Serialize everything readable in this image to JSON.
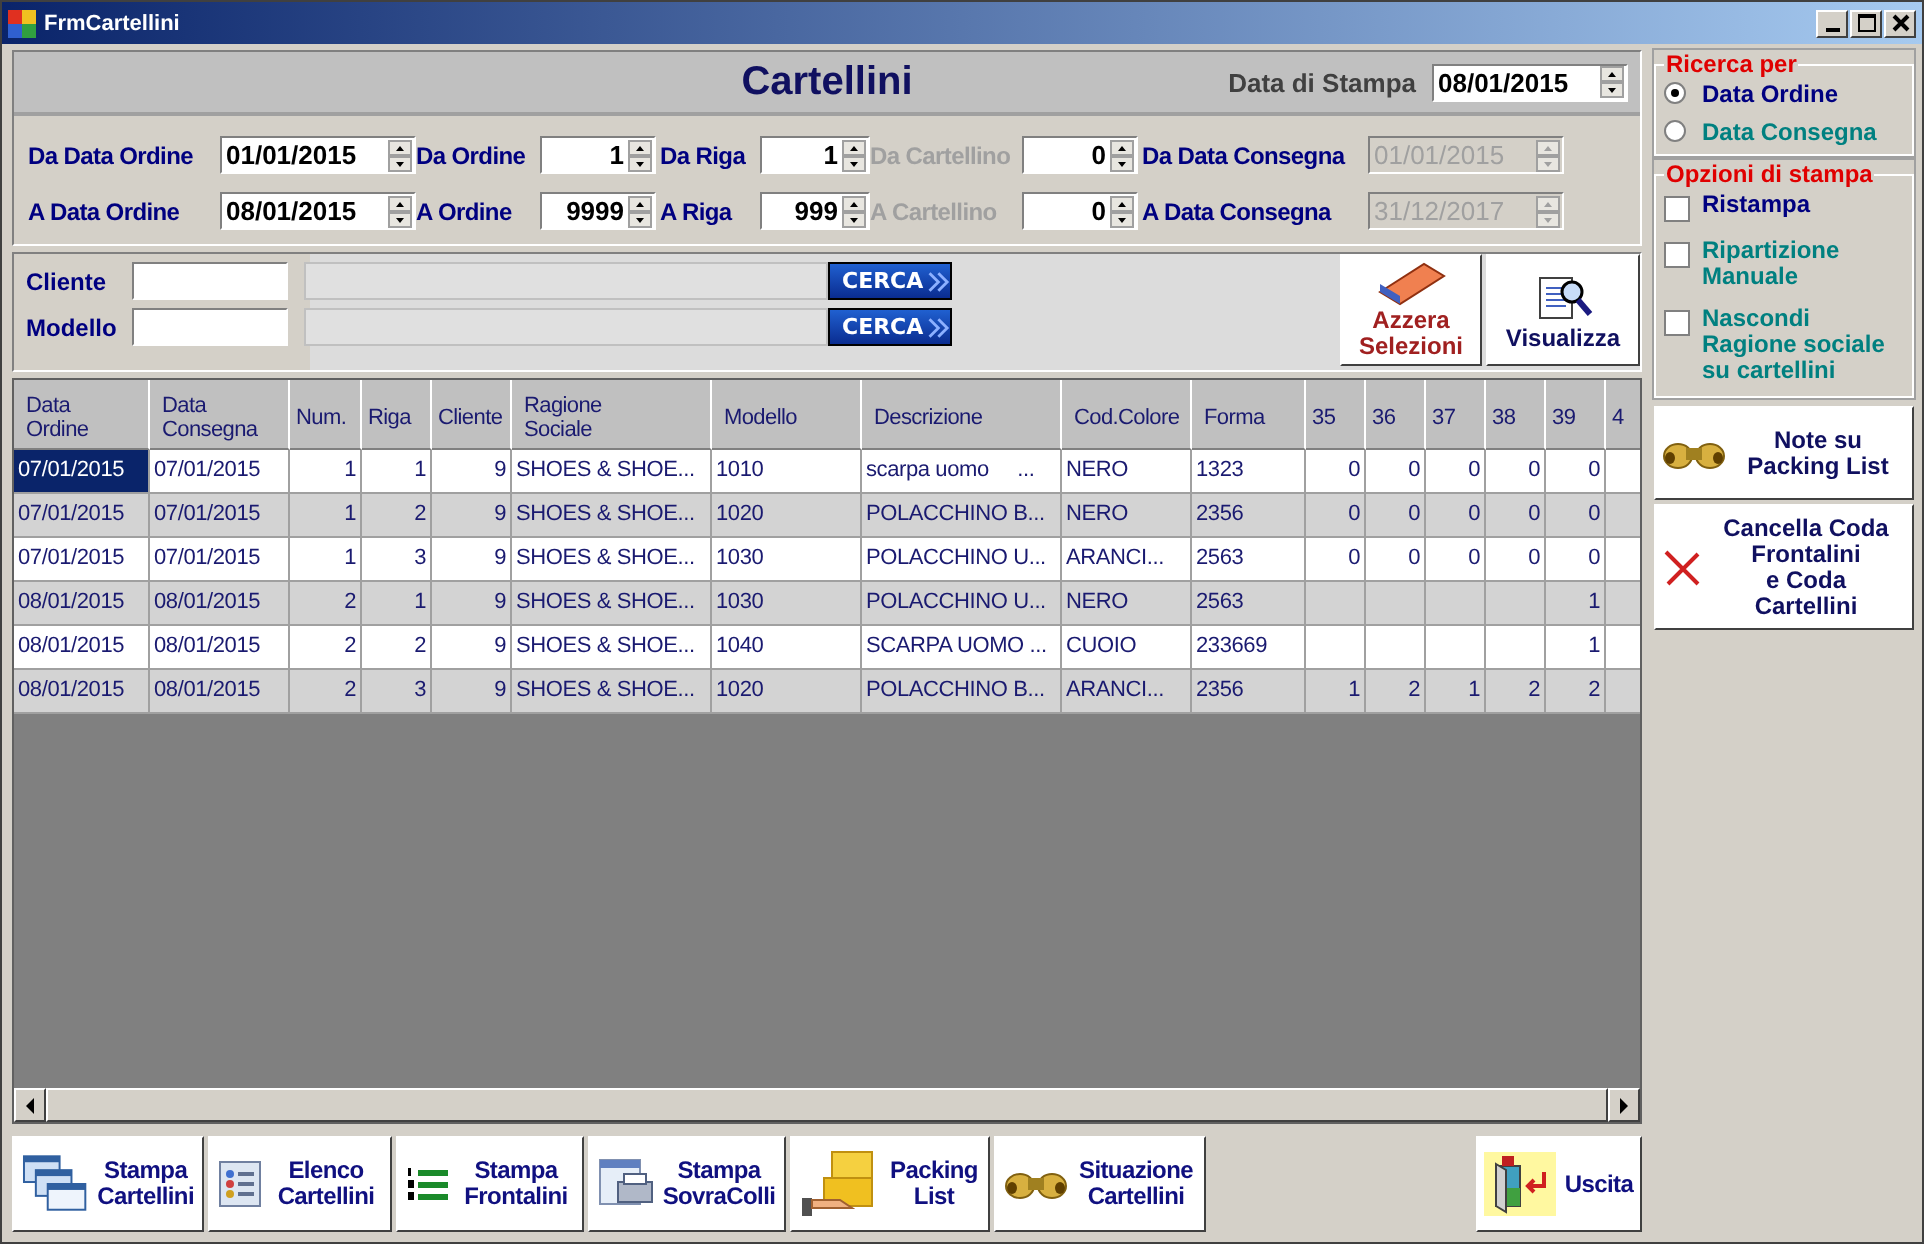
{
  "window": {
    "title": "FrmCartellini"
  },
  "header": {
    "title": "Cartellini",
    "print_date_label": "Data di Stampa",
    "print_date": "08/01/2015"
  },
  "filters": [
    [
      {
        "label": "Da Data Ordine",
        "value": "01/01/2015",
        "kind": "date",
        "label_disabled": false,
        "disabled": false
      },
      {
        "label": "Da Ordine",
        "value": "1",
        "kind": "number",
        "label_disabled": false,
        "disabled": false
      },
      {
        "label": "Da Riga",
        "value": "1",
        "kind": "number",
        "label_disabled": false,
        "disabled": false
      },
      {
        "label": "Da Cartellino",
        "value": "0",
        "kind": "number",
        "label_disabled": true,
        "disabled": false
      },
      {
        "label": "Da Data Consegna",
        "value": "01/01/2015",
        "kind": "date",
        "label_disabled": false,
        "disabled": true
      }
    ],
    [
      {
        "label": "A Data Ordine",
        "value": "08/01/2015",
        "kind": "date",
        "label_disabled": false,
        "disabled": false
      },
      {
        "label": "A Ordine",
        "value": "9999",
        "kind": "number",
        "label_disabled": false,
        "disabled": false
      },
      {
        "label": "A Riga",
        "value": "999",
        "kind": "number",
        "label_disabled": false,
        "disabled": false
      },
      {
        "label": "A Cartellino",
        "value": "0",
        "kind": "number",
        "label_disabled": true,
        "disabled": false
      },
      {
        "label": "A Data Consegna",
        "value": "31/12/2017",
        "kind": "date",
        "label_disabled": false,
        "disabled": true
      }
    ]
  ],
  "search": [
    {
      "label": "Cliente",
      "button": "CERCA"
    },
    {
      "label": "Modello",
      "button": "CERCA"
    }
  ],
  "actions": [
    {
      "label": "Azzera Selezioni",
      "kind": "eraser"
    },
    {
      "label": "Visualizza",
      "kind": "view"
    }
  ],
  "table": {
    "columns": [
      {
        "label": "Data\nOrdine",
        "kind": "text"
      },
      {
        "label": "Data\nConsegna",
        "kind": "text"
      },
      {
        "label": "Num.",
        "kind": "number"
      },
      {
        "label": "Riga",
        "kind": "number"
      },
      {
        "label": "Cliente",
        "kind": "number"
      },
      {
        "label": "Ragione\nSociale",
        "kind": "text"
      },
      {
        "label": "Modello",
        "kind": "text"
      },
      {
        "label": "Descrizione",
        "kind": "text"
      },
      {
        "label": "Cod.Colore",
        "kind": "text"
      },
      {
        "label": "Forma",
        "kind": "text"
      },
      {
        "label": "35",
        "kind": "number"
      },
      {
        "label": "36",
        "kind": "number"
      },
      {
        "label": "37",
        "kind": "number"
      },
      {
        "label": "38",
        "kind": "number"
      },
      {
        "label": "39",
        "kind": "number"
      },
      {
        "label": "4",
        "kind": "number"
      }
    ],
    "rows": [
      {
        "selected": true,
        "cells": [
          "07/01/2015",
          "07/01/2015",
          "1",
          "1",
          "9",
          "SHOES & SHOE...",
          "1010",
          "scarpa uomo     ...",
          "NERO",
          "1323",
          "0",
          "0",
          "0",
          "0",
          "0"
        ]
      },
      {
        "selected": false,
        "cells": [
          "07/01/2015",
          "07/01/2015",
          "1",
          "2",
          "9",
          "SHOES & SHOE...",
          "1020",
          "POLACCHINO B...",
          "NERO",
          "2356",
          "0",
          "0",
          "0",
          "0",
          "0"
        ]
      },
      {
        "selected": false,
        "cells": [
          "07/01/2015",
          "07/01/2015",
          "1",
          "3",
          "9",
          "SHOES & SHOE...",
          "1030",
          "POLACCHINO U...",
          "ARANCI...",
          "2563",
          "0",
          "0",
          "0",
          "0",
          "0"
        ]
      },
      {
        "selected": false,
        "cells": [
          "08/01/2015",
          "08/01/2015",
          "2",
          "1",
          "9",
          "SHOES & SHOE...",
          "1030",
          "POLACCHINO U...",
          "NERO",
          "2563",
          "",
          "",
          "",
          "",
          "1"
        ]
      },
      {
        "selected": false,
        "cells": [
          "08/01/2015",
          "08/01/2015",
          "2",
          "2",
          "9",
          "SHOES & SHOE...",
          "1040",
          "SCARPA UOMO ...",
          "CUOIO",
          "233669",
          "",
          "",
          "",
          "",
          "1"
        ]
      },
      {
        "selected": false,
        "cells": [
          "08/01/2015",
          "08/01/2015",
          "2",
          "3",
          "9",
          "SHOES & SHOE...",
          "1020",
          "POLACCHINO B...",
          "ARANCI...",
          "2356",
          "1",
          "2",
          "1",
          "2",
          "2"
        ]
      }
    ]
  },
  "search_by": {
    "title": "Ricerca per",
    "options": [
      {
        "label": "Data Ordine",
        "selected": true,
        "color": "#000080"
      },
      {
        "label": "Data Consegna",
        "selected": false,
        "color": "#008080"
      }
    ]
  },
  "print_options": {
    "title": "Opzioni di stampa",
    "options": [
      {
        "label": "Ristampa",
        "checked": false,
        "color": "#000080"
      },
      {
        "label": "Ripartizione\nManuale",
        "checked": false,
        "color": "#008080"
      },
      {
        "label": "Nascondi\nRagione sociale\nsu cartellini",
        "checked": false,
        "color": "#008080"
      }
    ]
  },
  "side_buttons": [
    {
      "label": "Note su\nPacking List",
      "kind": "binoculars"
    },
    {
      "label": "Cancella Coda\nFrontalini\ne Coda\nCartellini",
      "kind": "cross"
    }
  ],
  "toolbar": [
    {
      "label": "Stampa\nCartellini",
      "kind": "windows"
    },
    {
      "label": "Elenco\nCartellini",
      "kind": "list"
    },
    {
      "label": "Stampa\nFrontalini",
      "kind": "numbered"
    },
    {
      "label": "Stampa\nSovraColli",
      "kind": "print"
    },
    {
      "label": "Packing\nList",
      "kind": "boxes"
    },
    {
      "label": "Situazione\nCartellini",
      "kind": "binoculars"
    }
  ],
  "exit": {
    "label": "Uscita"
  }
}
